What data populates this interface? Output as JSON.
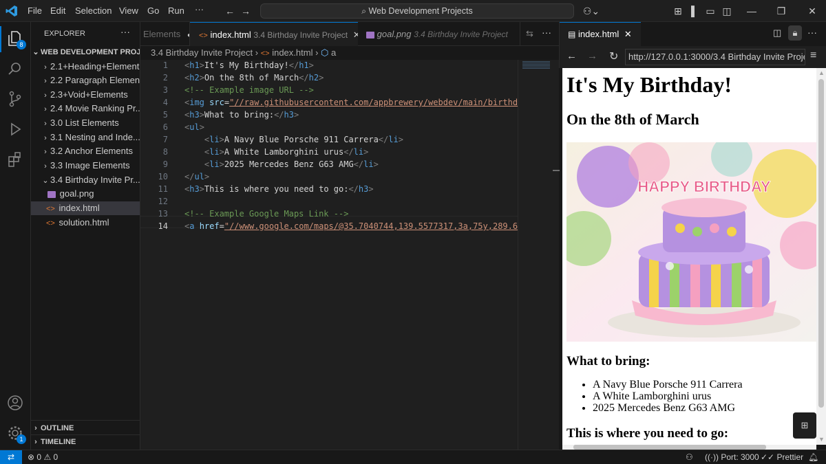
{
  "titlebar": {
    "menu": [
      "File",
      "Edit",
      "Selection",
      "View",
      "Go",
      "Run"
    ],
    "more": "···",
    "search_text": "Web Development Projects"
  },
  "sidebar": {
    "header": "EXPLORER",
    "header_more": "···",
    "root": "WEB DEVELOPMENT PROJ...",
    "folders": [
      "2.1+Heading+Element",
      "2.2 Paragraph Element",
      "2.3+Void+Elements",
      "2.4 Movie Ranking Pr...",
      "3.0 List Elements",
      "3.1 Nesting and Inde...",
      "3.2 Anchor Elements",
      "3.3 Image Elements",
      "3.4 Birthday Invite Pr..."
    ],
    "files": [
      "goal.png",
      "index.html",
      "solution.html"
    ],
    "outline": "OUTLINE",
    "timeline": "TIMELINE"
  },
  "activity": {
    "explorer_badge": "8",
    "settings_badge": "1"
  },
  "editor": {
    "tabs": [
      {
        "label": "Elements",
        "desc": ""
      },
      {
        "label": "index.html",
        "desc": "3.4 Birthday Invite Project"
      },
      {
        "label": "goal.png",
        "desc": "3.4 Birthday Invite Project"
      }
    ],
    "breadcrumb": {
      "folder": "3.4 Birthday Invite Project",
      "file": "index.html",
      "symbol": "a"
    },
    "line_numbers": [
      "1",
      "2",
      "3",
      "4",
      "5",
      "6",
      "7",
      "8",
      "9",
      "10",
      "11",
      "12",
      "13",
      "14"
    ]
  },
  "preview": {
    "tab_label": "index.html",
    "url": "http://127.0.0.1:3000/3.4 Birthday Invite Projec",
    "h1": "It's My Birthday!",
    "h2": "On the 8th of March",
    "h3_bring": "What to bring:",
    "items": [
      "A Navy Blue Porsche 911 Carrera",
      "A White Lamborghini urus",
      "2025 Mercedes Benz G63 AMG"
    ],
    "h3_go": "This is where you need to go:",
    "cake_letters": "HAPPY BIRTHDAY"
  },
  "status": {
    "errors": "0",
    "warnings": "0",
    "port": "Port: 3000",
    "prettier": "Prettier"
  },
  "colors": {
    "accent": "#0078d4",
    "tag": "#569cd6",
    "attr": "#9cdcfe",
    "string": "#ce9178",
    "comment": "#6a9955"
  }
}
